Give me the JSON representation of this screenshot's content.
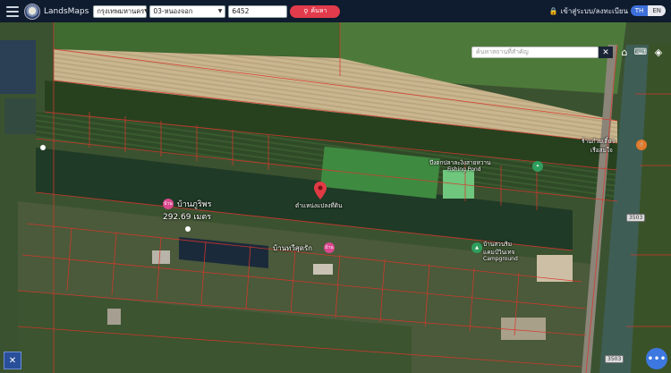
{
  "app": {
    "brand": "LandsMaps"
  },
  "topbar": {
    "province": "กรุงเทพมหานคร",
    "district": "03-หนองจอก",
    "parcel_number": "6452",
    "search_label": "ค้นหา",
    "login_label": "เข้าสู่ระบบ/ลงทะเบียน",
    "lang_th": "TH",
    "lang_en": "EN"
  },
  "map": {
    "search_placeholder": "ค้นหาสถานที่สำคัญ",
    "close_label": "✕",
    "parcel_marker_label": "ตำแหน่งแปลงที่ดิน",
    "parcel_area_label": "292.69 เมตร",
    "places": [
      {
        "name": "บ้านภูริพร",
        "badge": "บ้าน"
      },
      {
        "name": "บึงตกปลาละงิงสายหวาน",
        "sub": "Fishing Pond"
      },
      {
        "name": "ร้านก๋วยเตี๋ยว",
        "sub": "เรือสมใจ"
      },
      {
        "name": "บ้านทวีสุดรัก",
        "badge": "บ้าน"
      },
      {
        "name": "บ้านสวนริม",
        "sub": "แคมป์วินเทจ"
      },
      {
        "name": "Campground"
      }
    ],
    "road_shields": [
      "3503",
      "3503"
    ],
    "fab_label": "•••"
  }
}
